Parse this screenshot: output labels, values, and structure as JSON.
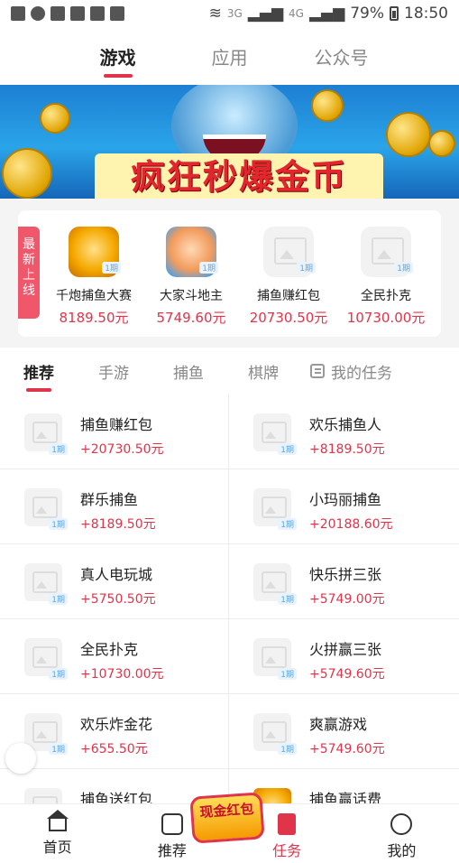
{
  "status_bar": {
    "net": "3G",
    "net2": "4G",
    "battery": "79%",
    "time": "18:50"
  },
  "top_tabs": [
    "游戏",
    "应用",
    "公众号"
  ],
  "banner": {
    "title": "疯狂秒爆金币"
  },
  "new_section": {
    "tag": "最新上线",
    "items": [
      {
        "name": "千炮捕鱼大赛",
        "amount": "8189.50元",
        "badge": "1期"
      },
      {
        "name": "大家斗地主",
        "amount": "5749.60元",
        "badge": "1期"
      },
      {
        "name": "捕鱼赚红包",
        "amount": "20730.50元",
        "badge": "1期"
      },
      {
        "name": "全民扑克",
        "amount": "10730.00元",
        "badge": "1期"
      }
    ]
  },
  "categories": [
    "推荐",
    "手游",
    "捕鱼",
    "棋牌",
    "我的任务"
  ],
  "games": [
    {
      "name": "捕鱼赚红包",
      "amount": "+20730.50元",
      "badge": "1期"
    },
    {
      "name": "欢乐捕鱼人",
      "amount": "+8189.50元",
      "badge": "1期"
    },
    {
      "name": "群乐捕鱼",
      "amount": "+8189.50元",
      "badge": "1期"
    },
    {
      "name": "小玛丽捕鱼",
      "amount": "+20188.60元",
      "badge": "1期"
    },
    {
      "name": "真人电玩城",
      "amount": "+5750.50元",
      "badge": "1期"
    },
    {
      "name": "快乐拼三张",
      "amount": "+5749.00元",
      "badge": "1期"
    },
    {
      "name": "全民扑克",
      "amount": "+10730.00元",
      "badge": "1期"
    },
    {
      "name": "火拼赢三张",
      "amount": "+5749.60元",
      "badge": "1期"
    },
    {
      "name": "欢乐炸金花",
      "amount": "+655.50元",
      "badge": "1期"
    },
    {
      "name": "爽赢游戏",
      "amount": "+5749.60元",
      "badge": "1期"
    },
    {
      "name": "捕鱼送红包",
      "amount": "",
      "badge": ""
    },
    {
      "name": "捕鱼赢话费",
      "amount": "",
      "badge": ""
    }
  ],
  "floating_promo": {
    "text": "现金红包"
  },
  "bottom_nav": [
    "首页",
    "推荐",
    "任务",
    "我的"
  ],
  "colors": {
    "accent": "#e0344b"
  }
}
